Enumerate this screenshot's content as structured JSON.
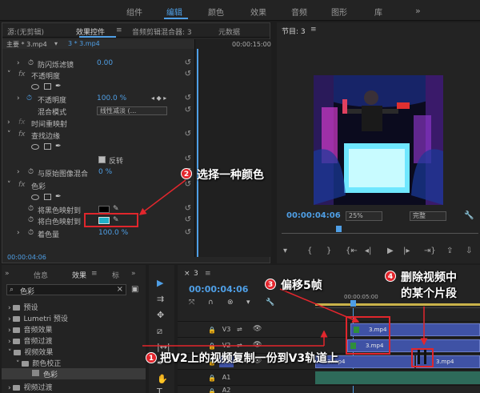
{
  "topnav": {
    "tabs": [
      "组件",
      "编辑",
      "颜色",
      "效果",
      "音频",
      "图形",
      "库"
    ],
    "active_index": 1,
    "more": "»"
  },
  "effect_controls": {
    "tabs": [
      "源:(无剪辑)",
      "效果控件",
      "音频剪辑混合器: 3",
      "元数据"
    ],
    "menu_icon": "≡",
    "active_tab": 1,
    "breadcrumb_master": "主要 * 3.mp4",
    "breadcrumb_clip": "3 * 3.mp4",
    "timecode_mini": "00:00:15:00",
    "rows": {
      "flicker_label": "防闪烁滤镜",
      "flicker_value": "0.00",
      "opacity_fx": "不透明度",
      "opacity_label": "不透明度",
      "opacity_value": "100.0 %",
      "blend_label": "混合模式",
      "blend_value": "线性减淡 (...",
      "time_remap": "时间重映射",
      "find_edges": "查找边缘",
      "invert_label": "反转",
      "blend_original": "与原始图像混合",
      "blend_original_value": "0 %",
      "tint_fx": "色彩",
      "map_black": "将黑色映射到",
      "map_white": "将白色映射到",
      "amount": "着色量",
      "amount_value": "100.0 %"
    },
    "bottom_timecode": "00:00:04:06",
    "tint_white_color": "#1fb0c8"
  },
  "program": {
    "title": "节目: 3",
    "menu_icon": "≡",
    "timecode": "00:00:04:06",
    "zoom": "25%",
    "quality": "完整"
  },
  "project": {
    "tabs": [
      "信息",
      "效果",
      "标"
    ],
    "menu_icon": "≡",
    "more": "»",
    "search_value": "色彩",
    "tree": [
      "预设",
      "Lumetri 预设",
      "音频效果",
      "音频过渡",
      "视频效果",
      "颜色校正",
      "色彩",
      "视频过渡"
    ]
  },
  "sequence": {
    "tab": "3",
    "menu_icon": "≡",
    "close": "×",
    "timecode": "00:00:04:06",
    "ruler_label": "00:00:05:00",
    "tracks": [
      "V3",
      "V2",
      "V1",
      "A1",
      "A2"
    ],
    "clip_label": "3.mp4"
  },
  "callouts": {
    "c1": {
      "num": "1",
      "text": "把V2上的视频复制一份到V3轨道上"
    },
    "c2": {
      "num": "2",
      "text": "选择一种颜色"
    },
    "c3": {
      "num": "3",
      "text": "偏移5帧"
    },
    "c4": {
      "num": "4",
      "line1": "删除视频中",
      "line2": "的某个片段"
    }
  },
  "colors": {
    "accent": "#4f9fe6",
    "callout_red": "#e3262d",
    "clip_blue": "#3f52a5"
  }
}
